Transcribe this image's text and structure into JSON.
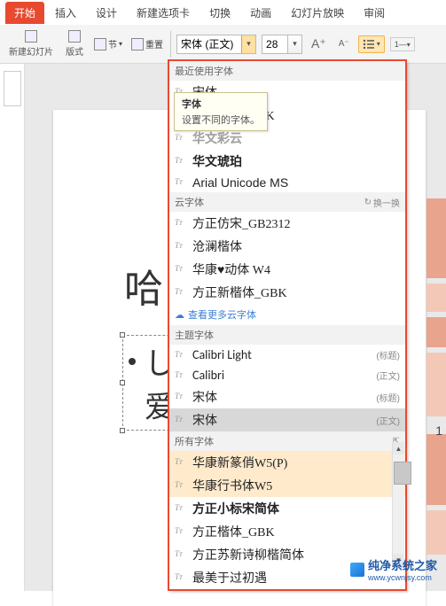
{
  "ribbon": {
    "tabs": [
      "开始",
      "插入",
      "设计",
      "新建选项卡",
      "切换",
      "动画",
      "幻灯片放映",
      "审阅"
    ],
    "active_tab": "开始",
    "new_slide": "新建幻灯片",
    "layout": "版式",
    "section": "节",
    "reset": "重置",
    "font_value": "宋体 (正文)",
    "size_value": "28"
  },
  "font_panel": {
    "recent_hdr": "最近使用字体",
    "recent": [
      {
        "name": "宋体",
        "style": "font-family:SimSun,serif"
      },
      {
        "name": "方正楷体_GBK",
        "style": "font-family:KaiTi,serif"
      },
      {
        "name": "华文彩云",
        "style": "font-family:sans-serif;color:#bbb;-webkit-text-stroke:0.5px #888"
      },
      {
        "name": "华文琥珀",
        "style": "font-family:sans-serif;font-weight:900"
      },
      {
        "name": "Arial Unicode MS",
        "style": "font-family:Arial,sans-serif"
      }
    ],
    "cloud_hdr": "云字体",
    "refresh": "换一换",
    "cloud": [
      {
        "name": "方正仿宋_GB2312",
        "style": "font-family:FangSong,serif"
      },
      {
        "name": "沧澜楷体",
        "style": "font-family:KaiTi,serif"
      },
      {
        "name": "华康♥动体 W4",
        "style": "font-family:cursive"
      },
      {
        "name": "方正新楷体_GBK",
        "style": "font-family:KaiTi,serif;font-weight:500"
      }
    ],
    "more_cloud": "查看更多云字体",
    "theme_hdr": "主题字体",
    "theme": [
      {
        "name": "Calibri Light",
        "tag": "(标题)",
        "style": "font-family:Calibri,Arial,sans-serif;font-weight:300"
      },
      {
        "name": "Calibri",
        "tag": "(正文)",
        "style": "font-family:Calibri,Arial,sans-serif"
      },
      {
        "name": "宋体",
        "tag": "(标题)",
        "style": "font-family:SimSun,serif"
      },
      {
        "name": "宋体",
        "tag": "(正文)",
        "style": "font-family:SimSun,serif",
        "hl": true
      }
    ],
    "all_hdr": "所有字体",
    "all": [
      {
        "name": "华康新篆俏W5(P)",
        "style": "font-family:serif",
        "cloud": true
      },
      {
        "name": "华康行书体W5",
        "style": "font-family:cursive",
        "cloud": true
      },
      {
        "name": "方正小标宋简体",
        "style": "font-family:SimSun,serif;font-weight:700"
      },
      {
        "name": "方正楷体_GBK",
        "style": "font-family:KaiTi,serif"
      },
      {
        "name": "方正苏新诗柳楷简体",
        "style": "font-family:KaiTi,serif"
      },
      {
        "name": "最美于过初遇",
        "style": "font-family:cursive"
      }
    ]
  },
  "tooltip": {
    "title": "字体",
    "body": "设置不同的字体。"
  },
  "slide": {
    "title": "哈",
    "bullet1_prefix": "し",
    "bullet1_rest": "爱"
  },
  "page_number": "1",
  "watermark": {
    "brand": "纯净系统之家",
    "url": "www.ycwnjsy.com"
  }
}
